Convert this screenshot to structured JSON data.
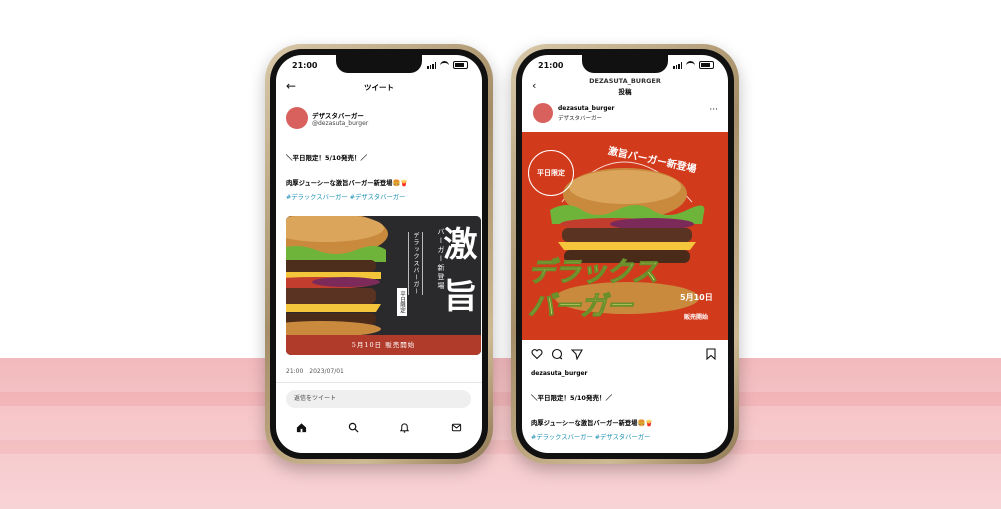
{
  "colors": {
    "accent_red": "#d23a1c",
    "avatar": "#d8605d",
    "hashtag": "#1b8fb5",
    "pink_bg": "#f4c0c3"
  },
  "twitter": {
    "status_time": "21:00",
    "header_title": "ツイート",
    "display_name": "デザスタバーガー",
    "handle": "@dezasuta_burger",
    "text_line1": "＼平日限定！5/10発売！／",
    "text_line2": "肉厚ジューシーな激旨バーガー新登場🍔🍟",
    "hashtags": "#デラックスバーガー #デザスタバーガー",
    "image": {
      "big_text_1": "激",
      "big_text_2": "旨",
      "vertical_1": "バーガー新登場",
      "vertical_2": "デラックスバーガー",
      "vertical_3": "平日限定",
      "strip": "5月10日 販売開始"
    },
    "timestamp": "21:00　2023/07/01",
    "reply_placeholder": "返信をツイート",
    "nav_icons": [
      "home-icon",
      "search-icon",
      "notifications-icon",
      "messages-icon"
    ]
  },
  "instagram": {
    "status_time": "21:00",
    "header_name": "DEZASUTA_BURGER",
    "header_sub": "投稿",
    "username": "dezasuta_burger",
    "user_sub": "デザスタバーガー",
    "more": "···",
    "image": {
      "badge": "平日限定",
      "arc_text": "激旨バーガー新登場",
      "title_1": "デラックス",
      "title_2": "バーガー",
      "date": "5月10日",
      "sale": "販売開始"
    },
    "caption_user": "dezasuta_burger",
    "text_line1": "＼平日限定！5/10発売！／",
    "text_line2": "肉厚ジューシーな激旨バーガー新登場🍔🍟",
    "hashtags": "#デラックスバーガー #デザスタバーガー"
  }
}
